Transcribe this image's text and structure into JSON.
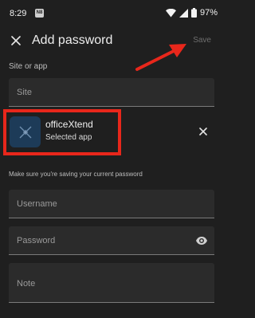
{
  "status_bar": {
    "time": "8:29",
    "badge": "N8",
    "battery": "97%"
  },
  "app_bar": {
    "title": "Add password",
    "save_label": "Save"
  },
  "site_section": {
    "label": "Site or app",
    "site_placeholder": "Site"
  },
  "selected_app": {
    "name": "officeXtend",
    "subtitle": "Selected app"
  },
  "credentials": {
    "hint": "Make sure you're saving your current password",
    "username_placeholder": "Username",
    "password_placeholder": "Password",
    "note_placeholder": "Note"
  },
  "colors": {
    "background": "#1f1f1f",
    "field": "#2b2b2b",
    "highlight": "#e8271b",
    "app_icon": "#1d3b58"
  },
  "icons": [
    "close-icon",
    "eye-icon",
    "remove-icon",
    "wifi-icon",
    "signal-icon",
    "battery-icon",
    "arrow-annotation"
  ]
}
